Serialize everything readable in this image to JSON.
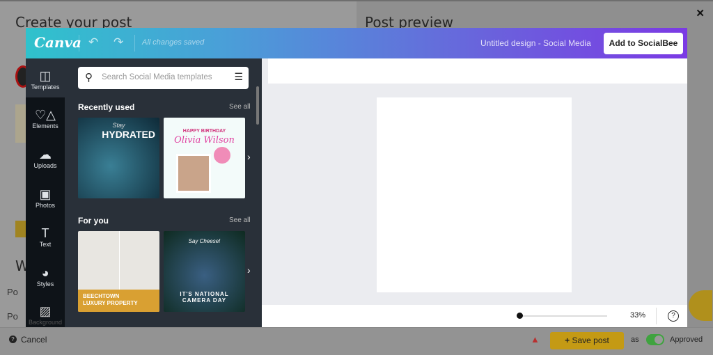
{
  "background": {
    "left_title": "Create your post",
    "right_title": "Post preview",
    "fragments": [
      "W",
      "Po",
      "Po"
    ],
    "close": "✕"
  },
  "footer": {
    "cancel": "Cancel",
    "save": "Save post",
    "as": "as",
    "approved": "Approved"
  },
  "canva": {
    "logo": "Canva",
    "status": "All changes saved",
    "design_title": "Untitled design - Social Media",
    "add_button": "Add to SocialBee",
    "sidebar": [
      {
        "label": "Templates",
        "icon": "templates-icon"
      },
      {
        "label": "Elements",
        "icon": "elements-icon"
      },
      {
        "label": "Uploads",
        "icon": "upload-icon"
      },
      {
        "label": "Photos",
        "icon": "photos-icon"
      },
      {
        "label": "Text",
        "icon": "text-icon"
      },
      {
        "label": "Styles",
        "icon": "palette-icon"
      },
      {
        "label": "Background",
        "icon": "background-icon"
      }
    ],
    "search": {
      "placeholder": "Search Social Media templates"
    },
    "sections": [
      {
        "title": "Recently used",
        "see_all": "See all",
        "items": [
          {
            "line1": "Stay",
            "line2": "HYDRATED"
          },
          {
            "line1": "HAPPY BIRTHDAY",
            "line2": "Olivia Wilson"
          }
        ]
      },
      {
        "title": "For you",
        "see_all": "See all",
        "items": [
          {
            "line1": "BEECHTOWN",
            "line2": "LUXURY PROPERTY"
          },
          {
            "line1": "Say Cheese!",
            "line2": "IT'S NATIONAL CAMERA DAY"
          }
        ]
      }
    ],
    "zoom": "33%",
    "zoom_level": 0.33,
    "help": "?"
  },
  "colors": {
    "accent": "#e8b81c",
    "toggle": "#3fa33f"
  }
}
